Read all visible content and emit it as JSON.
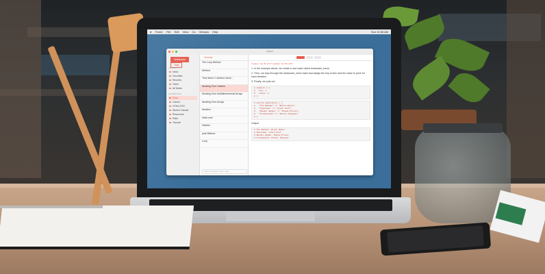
{
  "menubar": {
    "items": [
      "Finder",
      "File",
      "Edit",
      "View",
      "Go",
      "Window",
      "Help"
    ],
    "clock": "Sun 10:48 AM"
  },
  "window": {
    "title": "Quiver",
    "tabs": [
      "Notebooks",
      "Tags"
    ],
    "sidebar_headers": [
      "LIBRARY",
      "NOTEBOOKS"
    ],
    "sidebar_items": [
      "Inbox",
      "Favorites",
      "Recents",
      "Trash",
      "All Notes",
      "Ruby",
      "Cancel",
      "HTML/CSS",
      "Sketch Tutorial",
      "Resources",
      "Rails",
      "Tutorial"
    ],
    "list_title": "Chrome",
    "list_items": [
      {
        "title": "The Loop Method",
        "date": ""
      },
      {
        "title": "Method",
        "date": ""
      },
      {
        "title": "Time times 2 method, block...",
        "date": ""
      },
      {
        "title": "Iterating Over Hashes",
        "date": ""
      },
      {
        "title": "Iterating Over Multidimensional Arrays",
        "date": ""
      },
      {
        "title": "Iterating Over Arrays",
        "date": ""
      },
      {
        "title": "Iteration",
        "date": ""
      },
      {
        "title": "Hash.new",
        "date": ""
      },
      {
        "title": "Hashes",
        "date": ""
      },
      {
        "title": "puts Method",
        "date": ""
      },
      {
        "title": "Loop",
        "date": ""
      }
    ],
    "search_placeholder": "Filter by keyword, title or tags",
    "editor": {
      "meta": "Created: Jun 08, 2017   Updated: Jun 08, 2017",
      "lines": [
        "1. In the example above, we create a new hash called restaurant_menu.",
        "2. Then, we loop through the restaurant_menu hash and assign the key to item and the value to price for each iteration.",
        "3. Finally, we puts out"
      ],
      "code_blocks": [
        "1 numbers = [\n2   key: 1\n3   value: 2\n4 ]",
        "1 secret_identities = {\n2   \"The Batman\" => \"Bruce Wayne\",\n3   \"Superman\" => \"Clark Kent\",\n4   \"Wonder Woman\" => \"Diana Prince\",\n5   \"Freakazoid\" => \"Dexter Douglas\"\n6 }",
        "1 The Batman: Bruce Wayne\n2 Superman: Clark Kent\n3 Wonder Woman: Diana Prince\n4 Freakazoid: Dexter Douglas"
      ],
      "output_label": "Output"
    }
  },
  "colors": {
    "accent": "#e45b4c",
    "desktop": "#3b6f9a"
  }
}
